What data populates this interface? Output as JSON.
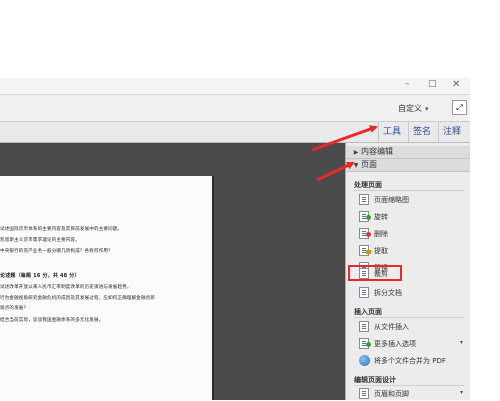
{
  "window": {
    "min_glyph": "–",
    "max_glyph": "□",
    "close_glyph": "✕"
  },
  "menubar": {
    "customize_label": "自定义",
    "customize_caret": "▾",
    "expand_glyph": "⤢"
  },
  "tabs": {
    "tools": "工具",
    "sign": "签名",
    "comment": "注释"
  },
  "document": {
    "lines": [
      "试述国际货币体系的主要内容及其目前发展中的主要问题。",
      "凯恩斯主义货币需求理论的主要内容。",
      "中央银行的资产业务一般分哪几项构成？各有何作用？",
      "论述题（每题 16 分，共 48 分）",
      "试述改革开放以来人民币汇率制度改革的历史演进与发展趋势。",
      "行为金融视角研究金融危机的成因及其发展过程，应如何正确理解金融创新",
      "观点的发展？",
      "结合当前实际，谈谈我国金融体系的多元化发展。"
    ]
  },
  "panel": {
    "section_content_edit": "内容编辑",
    "section_pages": "页面",
    "group_manage": "处理页面",
    "items_manage": [
      {
        "label": "页面缩略图",
        "icon": "thumbnails-icon"
      },
      {
        "label": "旋转",
        "icon": "rotate-icon"
      },
      {
        "label": "删除",
        "icon": "delete-page-icon"
      },
      {
        "label": "提取",
        "icon": "extract-icon"
      },
      {
        "label": "替换",
        "icon": "replace-icon"
      },
      {
        "label": "裁剪",
        "icon": "crop-icon"
      },
      {
        "label": "拆分文档",
        "icon": "split-icon"
      }
    ],
    "group_insert": "插入页面",
    "items_insert": [
      {
        "label": "从文件插入",
        "icon": "insert-file-icon"
      },
      {
        "label": "更多插入选项",
        "icon": "more-insert-icon",
        "more": "▾"
      },
      {
        "label": "将多个文件合并为 PDF",
        "icon": "combine-icon"
      }
    ],
    "group_design": "编辑页面设计",
    "items_design": [
      {
        "label": "页眉和页脚",
        "icon": "header-footer-icon",
        "more": "▾"
      }
    ]
  },
  "colors": {
    "annotation_red": "#e8282a",
    "link_blue": "#2a4f9a"
  }
}
